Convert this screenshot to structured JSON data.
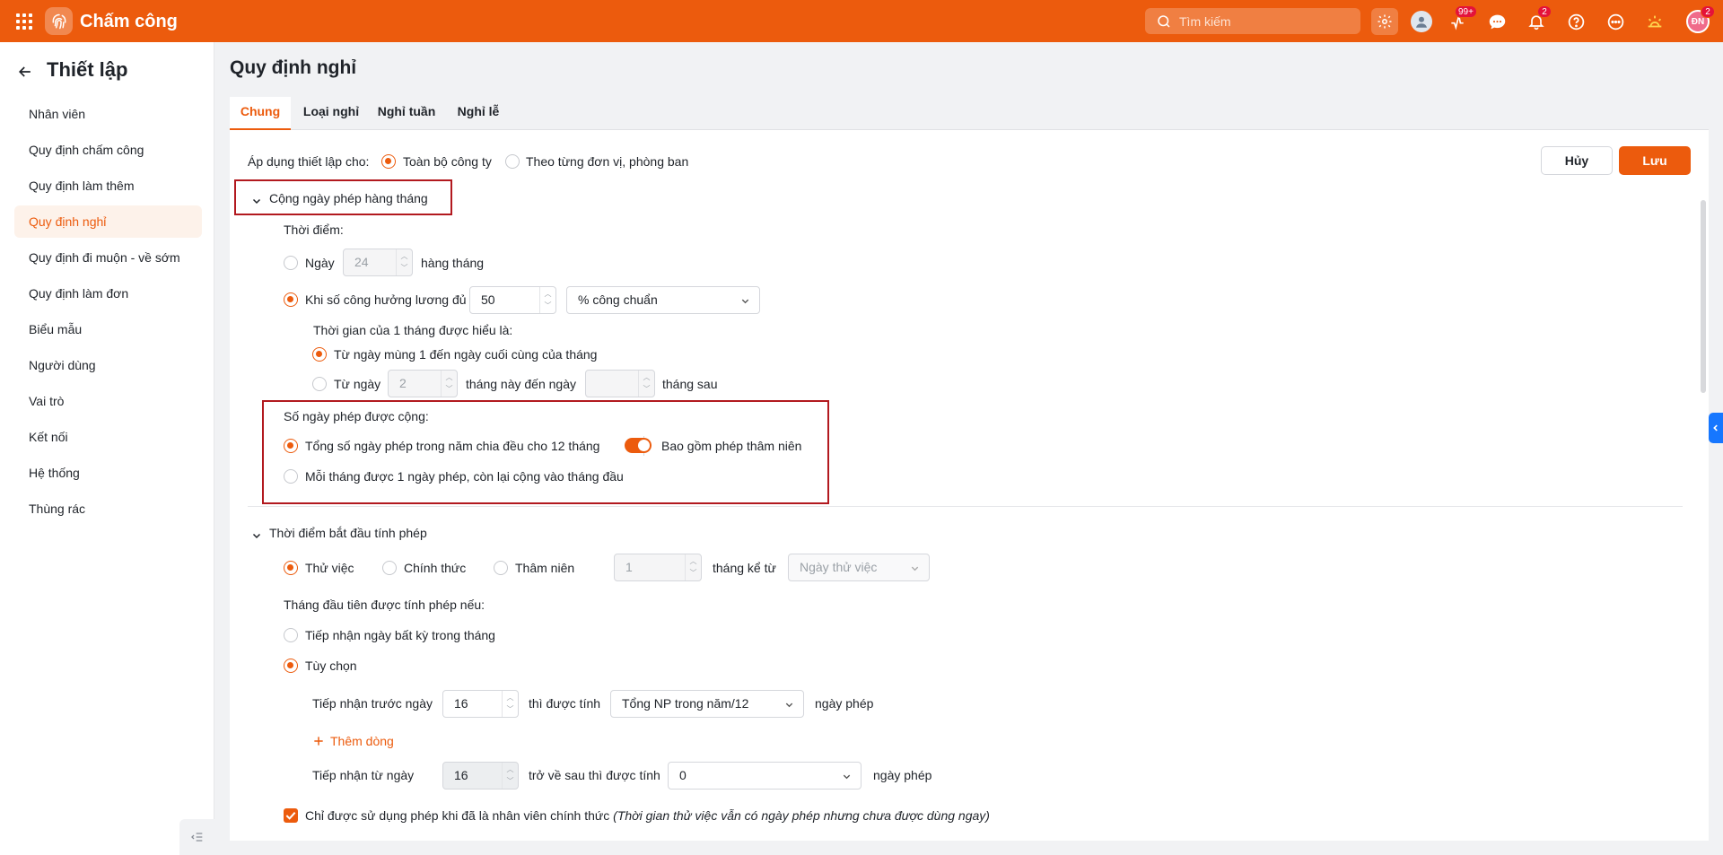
{
  "app": {
    "title": "Chấm công",
    "brand_color": "#ec5b0d"
  },
  "topbar": {
    "search_placeholder": "Tìm kiếm",
    "badges": {
      "tasks": "99+",
      "notifications": "2",
      "profile": "2"
    },
    "profile_initials": "ĐN"
  },
  "sidebar": {
    "title": "Thiết lập",
    "items": [
      {
        "label": "Nhân viên"
      },
      {
        "label": "Quy định chấm công"
      },
      {
        "label": "Quy định làm thêm"
      },
      {
        "label": "Quy định nghỉ",
        "active": true
      },
      {
        "label": "Quy định đi muộn - về sớm"
      },
      {
        "label": "Quy định làm đơn"
      },
      {
        "label": "Biểu mẫu"
      },
      {
        "label": "Người dùng"
      },
      {
        "label": "Vai trò"
      },
      {
        "label": "Kết nối"
      },
      {
        "label": "Hệ thống"
      },
      {
        "label": "Thùng rác"
      }
    ]
  },
  "page": {
    "title": "Quy định nghỉ"
  },
  "tabs": [
    {
      "label": "Chung",
      "active": true
    },
    {
      "label": "Loại nghỉ"
    },
    {
      "label": "Nghỉ tuần"
    },
    {
      "label": "Nghỉ lễ"
    }
  ],
  "apply": {
    "label": "Áp dụng thiết lập cho:",
    "option_company": "Toàn bộ công ty",
    "option_unit": "Theo từng đơn vị, phòng ban",
    "selected": "company"
  },
  "buttons": {
    "cancel": "Hủy",
    "save": "Lưu"
  },
  "monthly": {
    "title": "Cộng ngày phép hàng tháng",
    "timing_label": "Thời điểm:",
    "day_prefix": "Ngày",
    "day_value": "24",
    "day_suffix": "hàng tháng",
    "workday_label": "Khi số công hưởng lương đủ",
    "workday_value": "50",
    "workday_unit": "% công chuẩn",
    "month_def_label": "Thời gian của 1 tháng được hiểu là:",
    "month_def_opt1": "Từ ngày mùng 1 đến ngày cuối cùng của tháng",
    "month_def_opt2_prefix": "Từ ngày",
    "month_def_opt2_value": "2",
    "month_def_opt2_mid": "tháng này đến ngày",
    "month_def_opt2_suffix": "tháng sau"
  },
  "added_days": {
    "title": "Số ngày phép được cộng:",
    "opt1": "Tổng số ngày phép trong năm chia đều cho 12 tháng",
    "seniority_label": "Bao gồm phép thâm niên",
    "seniority_on": true,
    "opt2": "Mỗi tháng được 1 ngày phép, còn lại cộng vào tháng đầu"
  },
  "start": {
    "title": "Thời điểm bắt đầu tính phép",
    "opt_probation": "Thử việc",
    "opt_official": "Chính thức",
    "opt_seniority": "Thâm niên",
    "months_value": "1",
    "months_from": "tháng kể từ",
    "from_placeholder": "Ngày thử việc",
    "first_month_label": "Tháng đầu tiên được tính phép nếu:",
    "opt_any_day": "Tiếp nhận ngày bất kỳ trong tháng",
    "opt_custom": "Tùy chọn",
    "before_label": "Tiếp nhận trước ngày",
    "before_value": "16",
    "before_mid": "thì được tính",
    "before_select": "Tổng NP trong năm/12",
    "before_suffix": "ngày phép",
    "add_row": "Thêm dòng",
    "after_label": "Tiếp nhận từ ngày",
    "after_value": "16",
    "after_mid": "trở về sau thì được tính",
    "after_select": "0",
    "after_suffix": "ngày phép",
    "official_only_label": "Chỉ được sử dụng phép khi đã là nhân viên chính thức",
    "official_only_note": "(Thời gian thử việc vẫn có ngày phép nhưng chưa được dùng ngay)",
    "official_only_checked": true
  }
}
